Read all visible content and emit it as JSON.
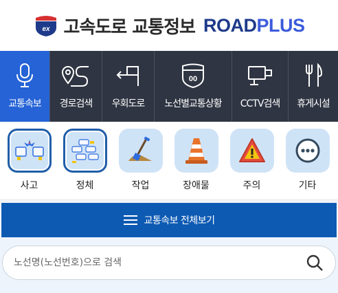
{
  "header": {
    "brand_ko": "고속도로 교통정보",
    "brand_en_road": "ROAD",
    "brand_en_plus": "PLUS",
    "logo_badge_text": "ex",
    "logo_icon": "ex-shield-logo"
  },
  "nav": {
    "items": [
      {
        "label": "교통속보",
        "icon": "microphone-icon",
        "active": true
      },
      {
        "label": "경로검색",
        "icon": "route-icon",
        "active": false
      },
      {
        "label": "우회도로",
        "icon": "detour-icon",
        "active": false
      },
      {
        "label": "노선별교통상황",
        "icon": "highway-shield-icon",
        "active": false
      },
      {
        "label": "CCTV검색",
        "icon": "cctv-icon",
        "active": false
      },
      {
        "label": "휴게시설",
        "icon": "utensils-icon",
        "active": false
      }
    ],
    "highway_number": "00"
  },
  "categories": {
    "items": [
      {
        "label": "사고",
        "icon": "accident-icon",
        "selected": true
      },
      {
        "label": "정체",
        "icon": "congestion-icon",
        "selected": true
      },
      {
        "label": "작업",
        "icon": "shovel-icon",
        "selected": false
      },
      {
        "label": "장애물",
        "icon": "traffic-cone-icon",
        "selected": false
      },
      {
        "label": "주의",
        "icon": "warning-triangle-icon",
        "selected": false
      },
      {
        "label": "기타",
        "icon": "more-dots-icon",
        "selected": false
      }
    ]
  },
  "fullview": {
    "label": "교통속보 전체보기",
    "icon": "hamburger-icon"
  },
  "search": {
    "placeholder": "노선명(노선번호)으로 검색",
    "value": "",
    "icon": "search-icon"
  },
  "colors": {
    "nav_bg": "#2f3542",
    "nav_active": "#2563d6",
    "fullbar_bg": "#0d5ab3",
    "category_tile": "#cfe3f7",
    "selected_border": "#1f5ea8",
    "brand_road": "#1e3a8a",
    "brand_plus": "#3b5bdb"
  }
}
